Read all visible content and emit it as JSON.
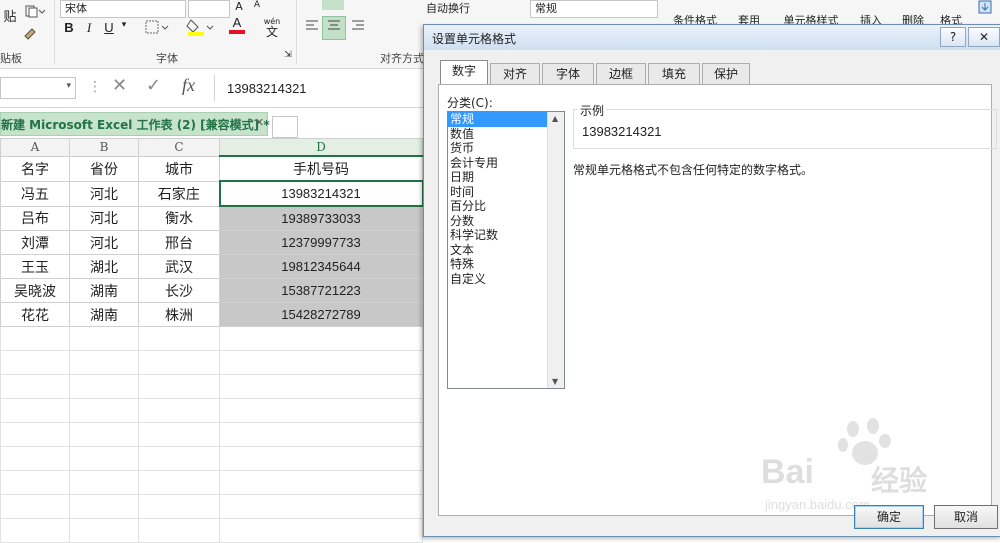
{
  "ribbon": {
    "clipboard_label": "贴板",
    "paste_label": "贴",
    "font_name": "宋体",
    "font_group_label": "字体",
    "bold": "B",
    "italic": "I",
    "underline": "U",
    "font_color_letter": "A",
    "phonetic": "wén",
    "phonetic_char": "文",
    "align_group_label": "对齐方式",
    "wrap_text": "自动换行",
    "number_format": "常规",
    "conditional_format": "条件格式",
    "apply": "套用",
    "cell_style": "单元格样式",
    "insert": "插入",
    "delete": "删除",
    "format": "格式"
  },
  "formula_bar": {
    "cancel": "✕",
    "enter": "✓",
    "fx": "fx",
    "value": "13983214321"
  },
  "workbook_tab": {
    "title": "新建 Microsoft Excel 工作表 (2)  [兼容模式] *",
    "close": "✕"
  },
  "sheet": {
    "columns": [
      "A",
      "B",
      "C",
      "D"
    ],
    "header_row": [
      "名字",
      "省份",
      "城市",
      "手机号码"
    ],
    "rows": [
      [
        "冯五",
        "河北",
        "石家庄",
        "13983214321"
      ],
      [
        "吕布",
        "河北",
        "衡水",
        "19389733033"
      ],
      [
        "刘潭",
        "河北",
        "邢台",
        "12379997733"
      ],
      [
        "王玉",
        "湖北",
        "武汉",
        "19812345644"
      ],
      [
        "吴晓波",
        "湖南",
        "长沙",
        "15387721223"
      ],
      [
        "花花",
        "湖南",
        "株洲",
        "15428272789"
      ]
    ]
  },
  "dialog": {
    "title": "设置单元格格式",
    "help": "?",
    "close": "✕",
    "tabs": [
      "数字",
      "对齐",
      "字体",
      "边框",
      "填充",
      "保护"
    ],
    "category_label": "分类(C):",
    "categories": [
      "常规",
      "数值",
      "货币",
      "会计专用",
      "日期",
      "时间",
      "百分比",
      "分数",
      "科学记数",
      "文本",
      "特殊",
      "自定义"
    ],
    "sample_label": "示例",
    "sample_value": "13983214321",
    "description": "常规单元格格式不包含任何特定的数字格式。",
    "ok": "确定",
    "cancel": "取消"
  },
  "watermark": {
    "brand": "Bai",
    "brand2": "经验",
    "url": "jingyan.baidu.com"
  },
  "colors": {
    "excel_green": "#217346",
    "selection_blue": "#3399ff"
  }
}
